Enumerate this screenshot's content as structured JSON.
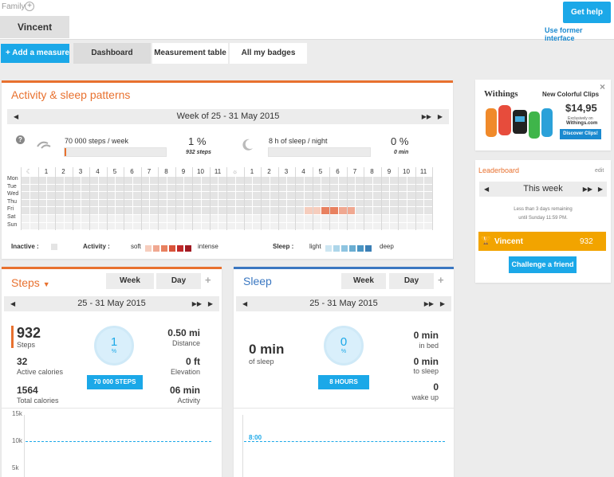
{
  "header": {
    "family_label": "Family",
    "family_add": "+",
    "user_tab": "Vincent",
    "get_help": "Get help",
    "former_interface": "Use former interface"
  },
  "nav": {
    "add_measure": "+ Add a measure",
    "tabs": [
      "Dashboard",
      "Measurement table",
      "All my badges"
    ],
    "active_tab": "Dashboard"
  },
  "patterns": {
    "title": "Activity & sleep patterns",
    "week": "Week of 25 - 31 May 2015",
    "steps_goal": "70 000 steps / week",
    "steps_pct": "1 %",
    "steps_count": "932 steps",
    "steps_progress": 0.013,
    "sleep_goal": "8 h of sleep / night",
    "sleep_pct": "0 %",
    "sleep_count": "0 min",
    "sleep_progress": 0,
    "hours_left": [
      "1",
      "2",
      "3",
      "4",
      "5",
      "6",
      "7",
      "8",
      "9",
      "10",
      "11"
    ],
    "hours_right": [
      "1",
      "2",
      "3",
      "4",
      "5",
      "6",
      "7",
      "8",
      "9",
      "10",
      "11"
    ],
    "days": [
      "Mon",
      "Tue",
      "Wed",
      "Thu",
      "Fri",
      "Sat",
      "Sun"
    ],
    "legend_inactive": "Inactive :",
    "legend_activity": "Activity :",
    "legend_soft": "soft",
    "legend_intense": "intense",
    "legend_sleep": "Sleep :",
    "legend_light": "light",
    "legend_deep": "deep",
    "activity_colors": [
      "#f6cdbd",
      "#f0a891",
      "#e8805f",
      "#d9533a",
      "#c0292a",
      "#a01a22"
    ],
    "sleep_colors": [
      "#cde6f2",
      "#add6ea",
      "#8ec4e0",
      "#6aaed2",
      "#4a95c3",
      "#3b7fb5"
    ]
  },
  "steps": {
    "title": "Steps",
    "tab_week": "Week",
    "tab_day": "Day",
    "add": "+",
    "range": "25 - 31 May 2015",
    "value": "932",
    "value_label": "Steps",
    "active_cal": "32",
    "active_cal_label": "Active calories",
    "total_cal": "1564",
    "total_cal_label": "Total calories",
    "pct": "1",
    "pct_sign": "%",
    "goal": "70 000 STEPS",
    "distance": "0.50 mi",
    "distance_label": "Distance",
    "elevation": "0 ft",
    "elevation_label": "Elevation",
    "activity": "06 min",
    "activity_label": "Activity",
    "y_ticks": [
      "15k",
      "10k",
      "5k"
    ]
  },
  "sleep": {
    "title": "Sleep",
    "tab_week": "Week",
    "tab_day": "Day",
    "add": "+",
    "range": "25 - 31 May 2015",
    "value": "0 min",
    "value_label": "of sleep",
    "pct": "0",
    "pct_sign": "%",
    "goal": "8 HOURS",
    "in_bed": "0 min",
    "in_bed_label": "in bed",
    "to_sleep": "0 min",
    "to_sleep_label": "to sleep",
    "wake_up": "0",
    "wake_up_label": "wake up",
    "goal_line": "8:00"
  },
  "ad": {
    "brand": "Withings",
    "headline": "New Colorful Clips",
    "price": "$14,95",
    "exclusive": "Exclusively on",
    "site": "Withings.com",
    "cta": "Discover Clips!",
    "close": "×"
  },
  "leaderboard": {
    "title": "Leaderboard",
    "edit": "edit",
    "period": "This week",
    "remaining": "Less than 3 days remaining",
    "until": "until Sunday 11:59 PM.",
    "leader_name": "Vincent",
    "leader_score": "932",
    "challenge": "Challenge a friend"
  }
}
